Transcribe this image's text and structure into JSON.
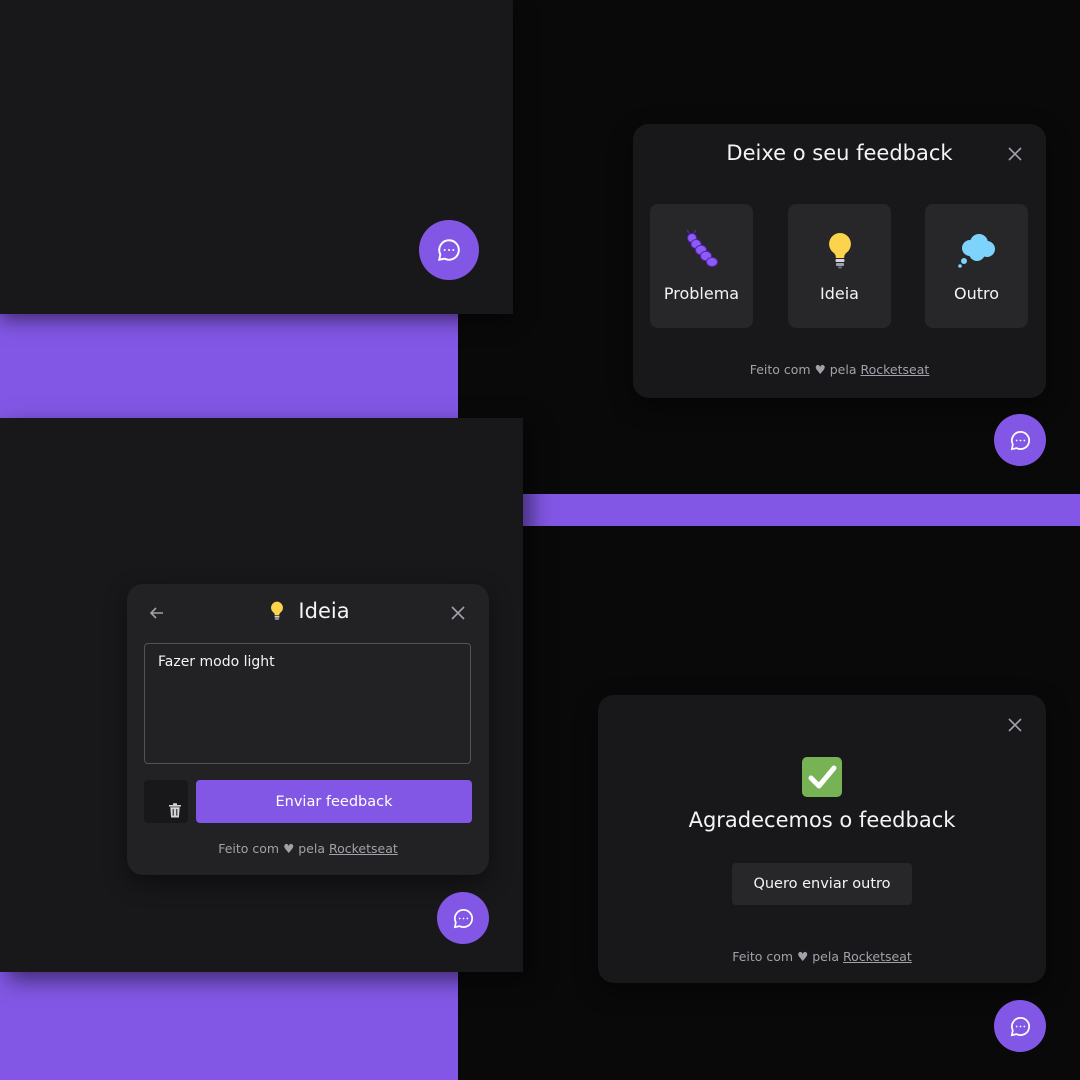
{
  "colors": {
    "brand": "#8257e5",
    "surface": "#18181b",
    "surface_light": "#27272a",
    "background": "#09090a"
  },
  "type_select": {
    "title": "Deixe o seu feedback",
    "close_icon": "close-icon",
    "options": [
      {
        "label": "Problema",
        "icon": "bug-icon"
      },
      {
        "label": "Ideia",
        "icon": "lightbulb-icon"
      },
      {
        "label": "Outro",
        "icon": "thought-bubble-icon"
      }
    ],
    "footer": {
      "prefix": "Feito com ♥ pela",
      "link": "Rocketseat"
    }
  },
  "content_step": {
    "title": "Ideia",
    "textarea_value": "Fazer modo light",
    "send_label": "Enviar feedback",
    "footer": {
      "prefix": "Feito com ♥ pela",
      "link": "Rocketseat"
    }
  },
  "success_step": {
    "title": "Agradecemos o feedback",
    "again_label": "Quero enviar outro",
    "footer": {
      "prefix": "Feito com ♥ pela",
      "link": "Rocketseat"
    }
  }
}
